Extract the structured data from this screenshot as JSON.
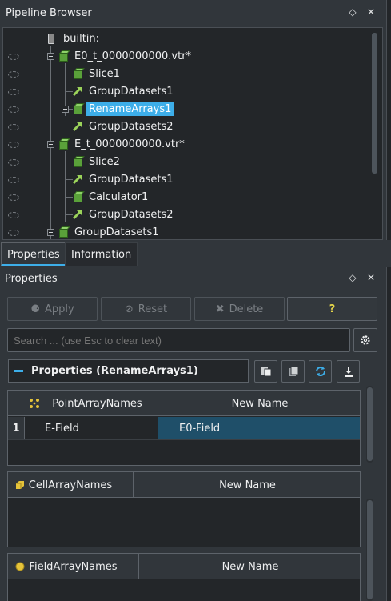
{
  "pipeline_browser": {
    "title": "Pipeline Browser",
    "float_glyph": "◇",
    "close_glyph": "✕",
    "items": [
      {
        "label": "builtin:",
        "icon": "server-icon"
      },
      {
        "label": "E0_t_0000000000.vtr*",
        "icon": "data-cube-icon"
      },
      {
        "label": "Slice1",
        "icon": "data-cube-icon"
      },
      {
        "label": "GroupDatasets1",
        "icon": "filter-arrow-icon"
      },
      {
        "label": "RenameArrays1",
        "icon": "data-cube-icon",
        "selected": true
      },
      {
        "label": "GroupDatasets2",
        "icon": "filter-arrow-icon"
      },
      {
        "label": "E_t_0000000000.vtr*",
        "icon": "data-cube-icon"
      },
      {
        "label": "Slice2",
        "icon": "data-cube-icon"
      },
      {
        "label": "GroupDatasets1",
        "icon": "filter-arrow-icon"
      },
      {
        "label": "Calculator1",
        "icon": "data-cube-icon"
      },
      {
        "label": "GroupDatasets2",
        "icon": "filter-arrow-icon"
      },
      {
        "label": "GroupDatasets1",
        "icon": "data-cube-icon"
      }
    ]
  },
  "tabs": [
    {
      "label": "Properties",
      "active": true
    },
    {
      "label": "Information",
      "active": false
    }
  ],
  "properties_panel": {
    "title": "Properties",
    "float_glyph": "◇",
    "close_glyph": "✕",
    "buttons": {
      "apply": "Apply",
      "reset": "Reset",
      "delete": "Delete",
      "help": "?"
    },
    "search": {
      "placeholder": "Search ... (use Esc to clear text)"
    },
    "section_title": "Properties (RenameArrays1)",
    "tables": [
      {
        "column_name": "PointArrayNames",
        "column_new": "New Name",
        "icon": "point-data-icon",
        "rows": [
          {
            "index": "1",
            "name": "E-Field",
            "new_name": "E0-Field"
          }
        ]
      },
      {
        "column_name": "CellArrayNames",
        "column_new": "New Name",
        "icon": "cell-data-icon",
        "rows": []
      },
      {
        "column_name": "FieldArrayNames",
        "column_new": "New Name",
        "icon": "field-data-icon",
        "rows": []
      }
    ]
  },
  "colors": {
    "accent": "#3daee9",
    "background": "#31363b",
    "view_background": "#232629",
    "selection_dark": "#1f4f69",
    "help_yellow": "#e5d54a"
  }
}
